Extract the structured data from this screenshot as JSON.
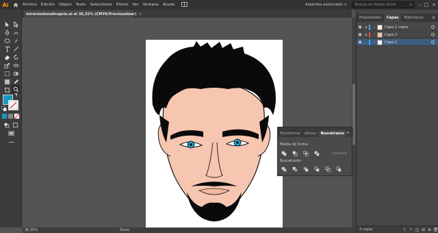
{
  "menubar": {
    "app_logo": "Ai",
    "items": [
      "Archivo",
      "Edición",
      "Objeto",
      "Texto",
      "Seleccionar",
      "Efecto",
      "Ver",
      "Ventana",
      "Ayuda"
    ],
    "workspace": "Aspectos esenciales",
    "stock_search_placeholder": "Buscar en Adobe Stock"
  },
  "document": {
    "tab_title": "mirentodosedicaprio.ai al 36,35% (CMYK/Previsualizar)",
    "close_glyph": "×"
  },
  "status": {
    "zoom": "36,35%",
    "label": "Zoom"
  },
  "layers_panel": {
    "tabs": [
      "Propiedades",
      "Capas",
      "Bibliotecas"
    ],
    "active_tab": "Capas",
    "layers": [
      {
        "name": "Capa 2 copia",
        "color": "#3fa8f5"
      },
      {
        "name": "Capa 2",
        "color": "#e84a4a"
      },
      {
        "name": "Capa 1",
        "color": "#3fa8f5"
      }
    ],
    "footer_count": "3 capas"
  },
  "pathfinder_panel": {
    "tabs": [
      "Transformar",
      "Alinear",
      "Buscatrazos"
    ],
    "active_tab": "Buscatrazos",
    "shape_modes_label": "Modos de forma:",
    "expand_label": "Expandir",
    "pathfinders_label": "Buscatrazos:"
  },
  "colors": {
    "accent": "#3e5d80",
    "fill_swatch": "#1899c3",
    "skin": "#f7c6b0",
    "hair": "#0a0a0a",
    "iris": "#1aa5c8"
  }
}
